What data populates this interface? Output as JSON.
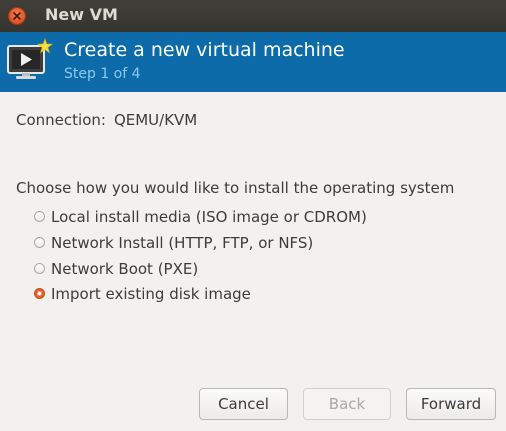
{
  "window": {
    "title": "New VM"
  },
  "header": {
    "title": "Create a new virtual machine",
    "step": "Step 1 of 4"
  },
  "connection": {
    "label": "Connection:",
    "value": "QEMU/KVM"
  },
  "install": {
    "prompt": "Choose how you would like to install the operating system",
    "options": [
      {
        "label": "Local install media (ISO image or CDROM)",
        "selected": false
      },
      {
        "label": "Network Install (HTTP, FTP, or NFS)",
        "selected": false
      },
      {
        "label": "Network Boot (PXE)",
        "selected": false
      },
      {
        "label": "Import existing disk image",
        "selected": true
      }
    ]
  },
  "buttons": {
    "cancel": "Cancel",
    "back": "Back",
    "forward": "Forward",
    "back_enabled": false
  },
  "colors": {
    "header_bg": "#0c6ba8",
    "step_text": "#8fc8ee",
    "radio_selected": "#e8682f",
    "titlebar_bg": "#3c3b37"
  },
  "icons": {
    "close": "close-icon",
    "header": "virtual-machine-icon"
  }
}
